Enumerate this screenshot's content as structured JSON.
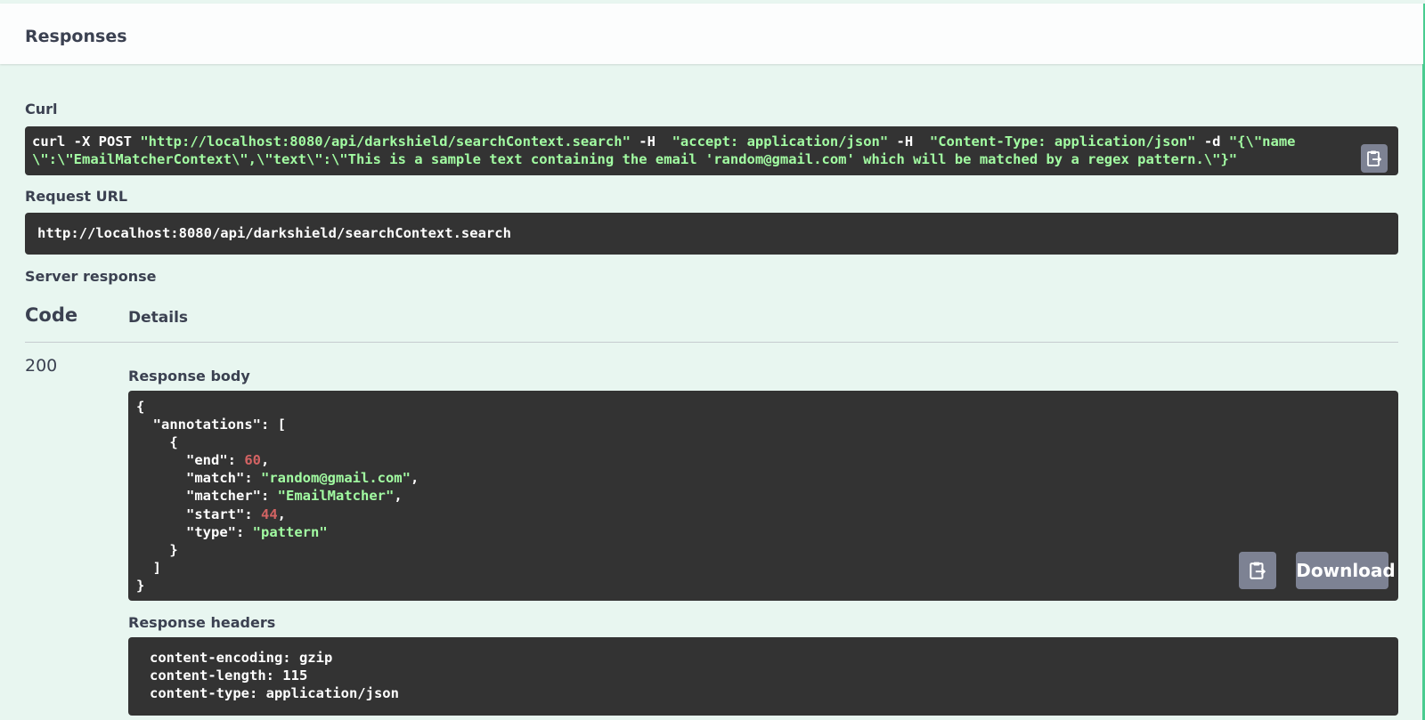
{
  "header": {
    "title": "Responses"
  },
  "curl": {
    "label": "Curl",
    "line1": {
      "cmd": "curl -X POST ",
      "url": "\"http://localhost:8080/api/darkshield/searchContext.search\"",
      "flag1": " -H  ",
      "accept": "\"accept: application/json\"",
      "flag2": " -H  ",
      "ctype": "\"Content-Type: application/json\"",
      "flag3": " -d ",
      "data_start": "\"{\\\"name"
    },
    "line2": "\\\":\\\"EmailMatcherContext\\\",\\\"text\\\":\\\"This is a sample text containing the email 'random@gmail.com' which will be matched by a regex pattern.\\\"}\""
  },
  "request_url": {
    "label": "Request URL",
    "value": "http://localhost:8080/api/darkshield/searchContext.search"
  },
  "server_response": {
    "label": "Server response",
    "code_header": "Code",
    "details_header": "Details",
    "code": "200",
    "body_label": "Response body",
    "headers_label": "Response headers",
    "body": {
      "open": "{",
      "annotations_key": "\"annotations\"",
      "bracket_open": "[",
      "obj_open": "{",
      "end_key": "\"end\"",
      "end_val": "60",
      "match_key": "\"match\"",
      "match_val": "\"random@gmail.com\"",
      "matcher_key": "\"matcher\"",
      "matcher_val": "\"EmailMatcher\"",
      "start_key": "\"start\"",
      "start_val": "44",
      "type_key": "\"type\"",
      "type_val": "\"pattern\"",
      "obj_close": "}",
      "bracket_close": "]",
      "close": "}"
    },
    "download_label": "Download",
    "headers": [
      "content-encoding: gzip",
      "content-length: 115",
      "content-type: application/json"
    ]
  },
  "icons": {
    "copy": "clipboard-icon"
  },
  "colors": {
    "accent": "#49cc90",
    "code_bg": "#333333",
    "string": "#a2fca2",
    "number": "#d36363",
    "button": "#7d8293"
  }
}
